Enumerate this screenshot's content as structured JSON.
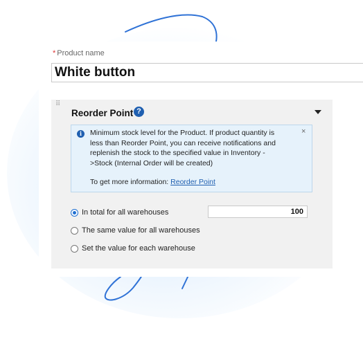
{
  "product_name": {
    "required_mark": "*",
    "label": "Product name",
    "value": "White button"
  },
  "reorder_panel": {
    "drag_handle": "⠿",
    "title": "Reorder Point",
    "help_icon": "?",
    "collapse_icon": "caret-down",
    "info": {
      "icon": "i",
      "text": "Minimum stock level for the Product. If product quantity is less than Reorder Point, you can receive notifications and replenish the stock to the specified value in Inventory ->Stock (Internal Order will be created)",
      "close": "×",
      "more_prefix": "To get more information:",
      "more_link": "Reorder Point"
    },
    "options": [
      {
        "label": "In total for all warehouses",
        "selected": true
      },
      {
        "label": "The same value for all warehouses",
        "selected": false
      },
      {
        "label": "Set the value for each warehouse",
        "selected": false
      }
    ],
    "total_value": "100"
  },
  "colors": {
    "accent": "#1f5fb0",
    "radio": "#1f6fd1",
    "info_bg": "#e6f2fb",
    "panel_bg": "#f1f1f1",
    "scribble": "#2f72d6"
  }
}
